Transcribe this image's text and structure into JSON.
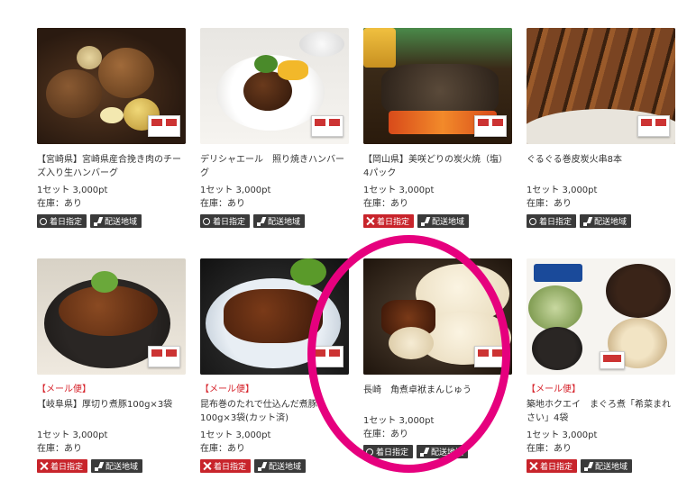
{
  "products_row1": [
    {
      "name": "【宮崎県】宮崎県産合挽き肉のチーズ入り生ハンバーグ",
      "price": "1セット 3,000pt",
      "stock": "在庫：あり",
      "delivery_date_tag": "着日指定",
      "delivery_date_available": true,
      "area_tag": "配送地域"
    },
    {
      "name": "デリシャエール　照り焼きハンバーグ",
      "price": "1セット 3,000pt",
      "stock": "在庫：あり",
      "delivery_date_tag": "着日指定",
      "delivery_date_available": true,
      "area_tag": "配送地域"
    },
    {
      "name": "【岡山県】美咲どりの炭火焼（塩）4パック",
      "price": "1セット 3,000pt",
      "stock": "在庫：あり",
      "delivery_date_tag": "着日指定",
      "delivery_date_available": false,
      "area_tag": "配送地域"
    },
    {
      "name": "ぐるぐる巻皮炭火串8本",
      "price": "1セット 3,000pt",
      "stock": "在庫：あり",
      "delivery_date_tag": "着日指定",
      "delivery_date_available": true,
      "area_tag": "配送地域"
    }
  ],
  "products_row2": [
    {
      "mail": "【メール便】",
      "name": "【岐阜県】厚切り煮豚100g×3袋",
      "price": "1セット 3,000pt",
      "stock": "在庫：あり",
      "delivery_date_tag": "着日指定",
      "delivery_date_available": false,
      "area_tag": "配送地域"
    },
    {
      "mail": "【メール便】",
      "name": "昆布巻のたれで仕込んだ煮豚100g×3袋(カット済)",
      "price": "1セット 3,000pt",
      "stock": "在庫：あり",
      "delivery_date_tag": "着日指定",
      "delivery_date_available": false,
      "area_tag": "配送地域"
    },
    {
      "mail": "",
      "name": "長崎　角煮卓袱まんじゅう",
      "price": "1セット 3,000pt",
      "stock": "在庫：あり",
      "delivery_date_tag": "着日指定",
      "delivery_date_available": true,
      "area_tag": "配送地域"
    },
    {
      "mail": "【メール便】",
      "name": "築地ホクエイ　まぐろ煮「希菜まれさい」4袋",
      "price": "1セット 3,000pt",
      "stock": "在庫：あり",
      "delivery_date_tag": "着日指定",
      "delivery_date_available": false,
      "area_tag": "配送地域"
    }
  ],
  "colors": {
    "accent_red": "#d6222a",
    "tag_dark": "#3a3a3a",
    "highlight_ring": "#e6007e"
  },
  "icons": {
    "available": "circle-icon",
    "unavailable": "cross-icon",
    "area": "japan-map-icon"
  }
}
